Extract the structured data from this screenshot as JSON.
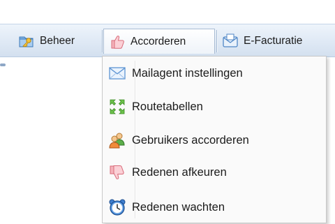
{
  "menubar": {
    "items": [
      {
        "label": "Beheer",
        "icon": "key-folder-icon"
      },
      {
        "label": "Accorderen",
        "icon": "thumbs-up-icon",
        "active": true
      },
      {
        "label": "E-Facturatie",
        "icon": "email-envelope-icon"
      }
    ]
  },
  "dropdown": {
    "items": [
      {
        "label": "Mailagent instellingen",
        "icon": "envelope-icon"
      },
      {
        "label": "Routetabellen",
        "icon": "expand-arrows-icon"
      },
      {
        "label": "Gebruikers accorderen",
        "icon": "users-icon"
      },
      {
        "label": "Redenen afkeuren",
        "icon": "thumbs-down-icon"
      },
      {
        "label": "Redenen wachten",
        "icon": "alarm-clock-icon"
      }
    ]
  },
  "colors": {
    "menubar_bg": "#dfe9f5",
    "dropdown_bg": "#fafafa",
    "text": "#1b1b1b"
  }
}
